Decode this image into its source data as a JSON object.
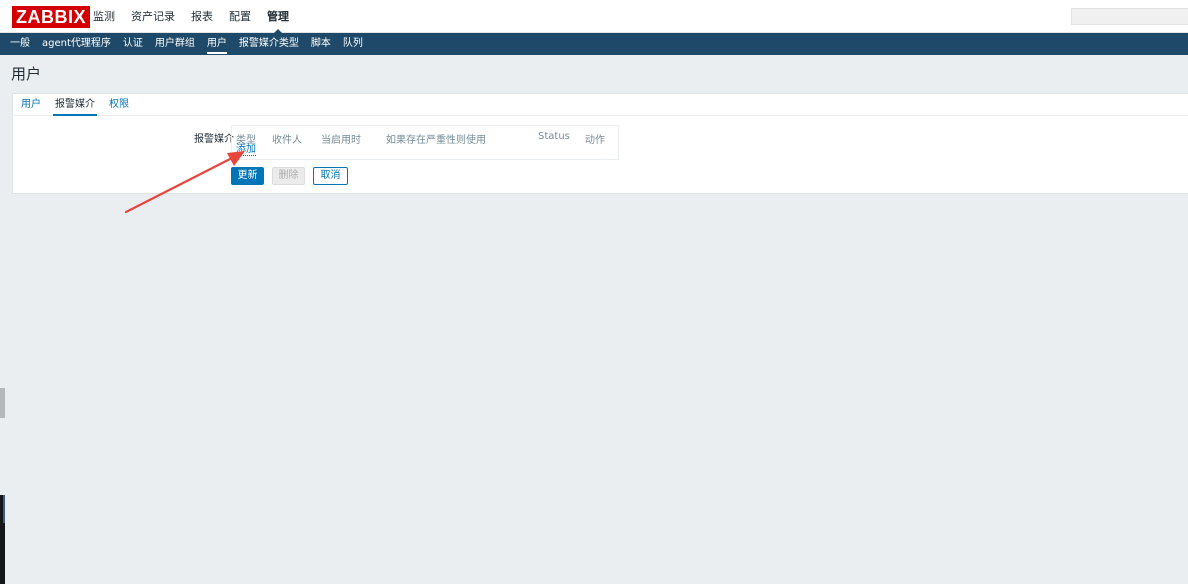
{
  "header": {
    "logo": "ZABBIX",
    "menu": [
      {
        "label": "监测"
      },
      {
        "label": "资产记录"
      },
      {
        "label": "报表"
      },
      {
        "label": "配置"
      },
      {
        "label": "管理",
        "selected": true
      }
    ]
  },
  "subnav": {
    "items": [
      {
        "label": "一般"
      },
      {
        "label": "agent代理程序"
      },
      {
        "label": "认证"
      },
      {
        "label": "用户群组"
      },
      {
        "label": "用户",
        "selected": true
      },
      {
        "label": "报警媒介类型"
      },
      {
        "label": "脚本"
      },
      {
        "label": "队列"
      }
    ]
  },
  "page": {
    "title": "用户"
  },
  "tabs": [
    {
      "label": "用户"
    },
    {
      "label": "报警媒介",
      "selected": true
    },
    {
      "label": "权限"
    }
  ],
  "media": {
    "label": "报警媒介",
    "columns": {
      "type": "类型",
      "send_to": "收件人",
      "when_active": "当启用时",
      "use_if_severity": "如果存在严重性则使用",
      "status": "Status",
      "action": "动作"
    },
    "add_link": "添加"
  },
  "buttons": {
    "update": "更新",
    "delete": "删除",
    "cancel": "取消"
  },
  "colors": {
    "brand_red": "#d40000",
    "nav_blue": "#1f4968",
    "link_blue": "#0275b8",
    "annotation_arrow": "#e8453c"
  }
}
